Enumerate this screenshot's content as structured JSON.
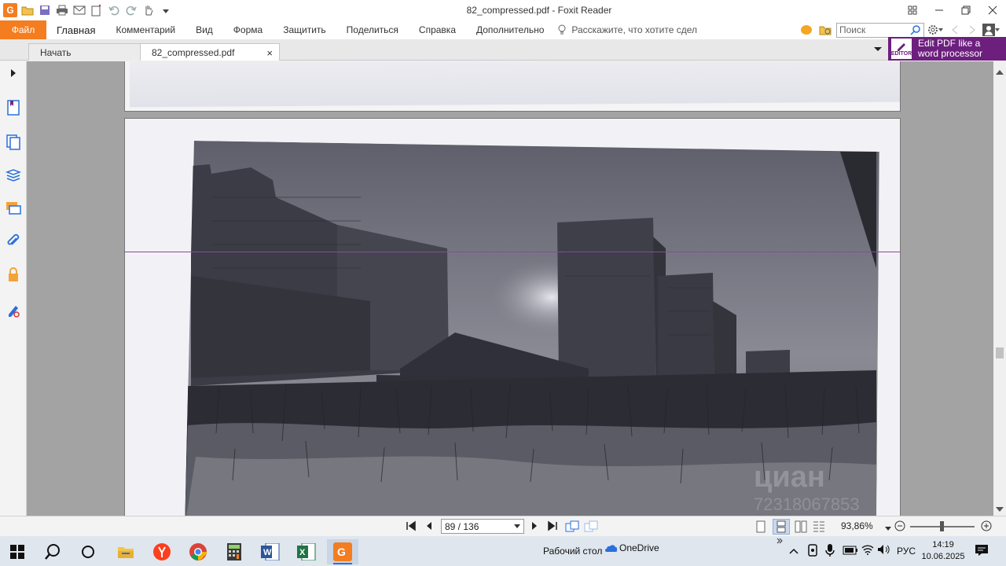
{
  "window": {
    "title": "82_compressed.pdf - Foxit Reader",
    "app_logo_letter": "G"
  },
  "menu": {
    "file": "Файл",
    "items": [
      "Главная",
      "Комментарий",
      "Вид",
      "Форма",
      "Защитить",
      "Поделиться",
      "Справка",
      "Дополнительно"
    ],
    "tell_me": "Расскажите, что хотите сдел",
    "search_placeholder": "Поиск"
  },
  "tabs": [
    {
      "label": "Начать"
    },
    {
      "label": "82_compressed.pdf",
      "close": "×"
    }
  ],
  "promo": {
    "badge": "EDITOR",
    "line1": "Edit PDF like a",
    "line2": "word processor"
  },
  "sidebar_icons": [
    "bookmark-icon",
    "pages-icon",
    "layers-icon",
    "comments-icon",
    "attachments-icon",
    "security-icon",
    "signature-icon"
  ],
  "document": {
    "watermark": "циан",
    "watermark_sub": "72318067853"
  },
  "navigation": {
    "page_current": "89",
    "page_total": "136",
    "page_display": "89 / 136",
    "zoom": "93,86%",
    "zoom_fraction": 0.47
  },
  "taskbar": {
    "desktop_label": "Рабочий стол",
    "onedrive_label": "OneDrive",
    "language": "РУС",
    "time": "14:19",
    "date": "10.06.2025",
    "apps": [
      "start-icon",
      "search-icon",
      "taskview-icon",
      "file-explorer-icon",
      "yandex-browser-icon",
      "chrome-icon",
      "calculator-icon",
      "word-icon",
      "excel-icon",
      "foxit-reader-icon"
    ],
    "colors": {
      "accent": "#f47d20",
      "promo": "#6d1f7e",
      "word": "#2b579a",
      "excel": "#217346"
    }
  }
}
